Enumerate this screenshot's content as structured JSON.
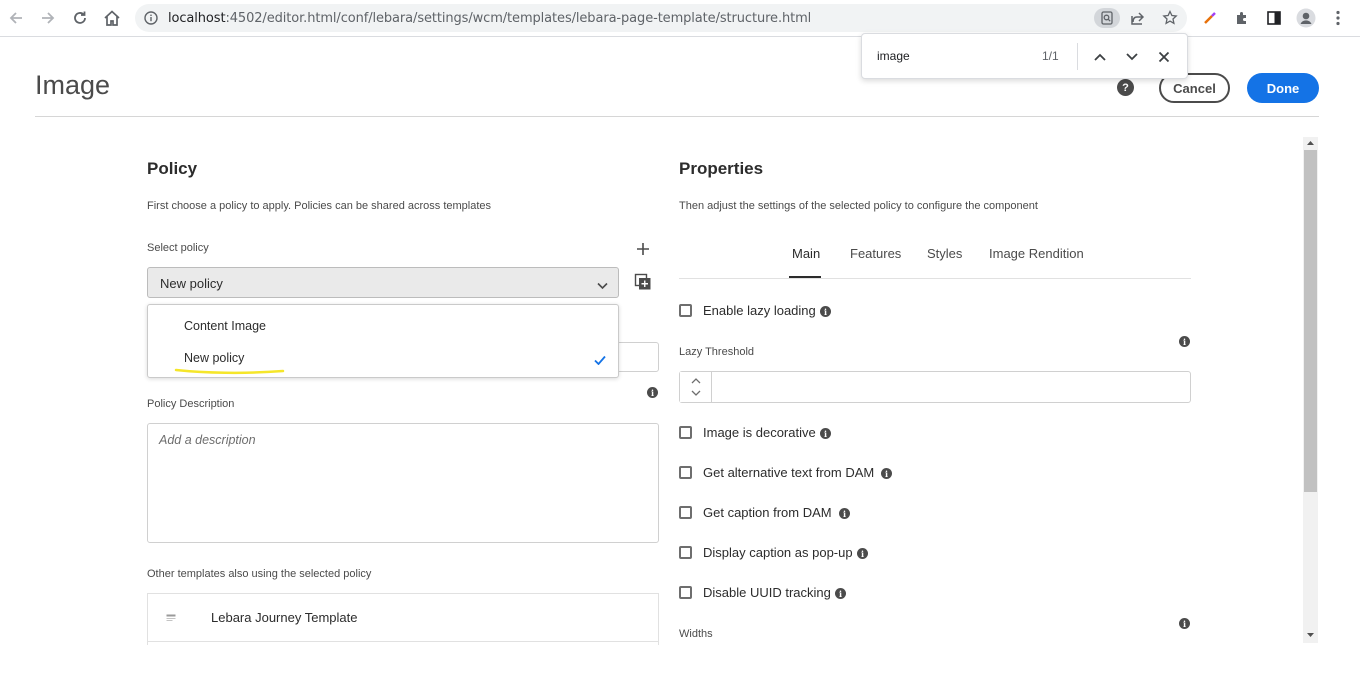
{
  "browser": {
    "url_host": "localhost",
    "url_rest": ":4502/editor.html/conf/lebara/settings/wcm/templates/lebara-page-template/structure.html",
    "find": {
      "query": "image",
      "count": "1/1"
    }
  },
  "dialog": {
    "title": "Image",
    "help": "?",
    "cancel_label": "Cancel",
    "done_label": "Done"
  },
  "policy": {
    "heading": "Policy",
    "description": "First choose a policy to apply. Policies can be shared across templates",
    "select_label": "Select policy",
    "selected_value": "New policy",
    "options": [
      "Content Image",
      "New policy"
    ],
    "policy_description_label": "Policy Description",
    "policy_description_placeholder": "Add a description",
    "other_templates_label": "Other templates also using the selected policy",
    "templates": [
      "Lebara Journey Template"
    ]
  },
  "properties": {
    "heading": "Properties",
    "description": "Then adjust the settings of the selected policy to configure the component",
    "tabs": [
      "Main",
      "Features",
      "Styles",
      "Image Rendition"
    ],
    "active_tab": "Main",
    "lazy_loading_label": "Enable lazy loading",
    "lazy_threshold_label": "Lazy Threshold",
    "decorative_label": "Image is decorative",
    "alt_text_label": "Get alternative text from DAM",
    "caption_label": "Get caption from DAM",
    "popup_label": "Display caption as pop-up",
    "uuid_label": "Disable UUID tracking",
    "widths_label": "Widths"
  },
  "colors": {
    "accent": "#1473e6",
    "highlight": "#f5e62a"
  }
}
